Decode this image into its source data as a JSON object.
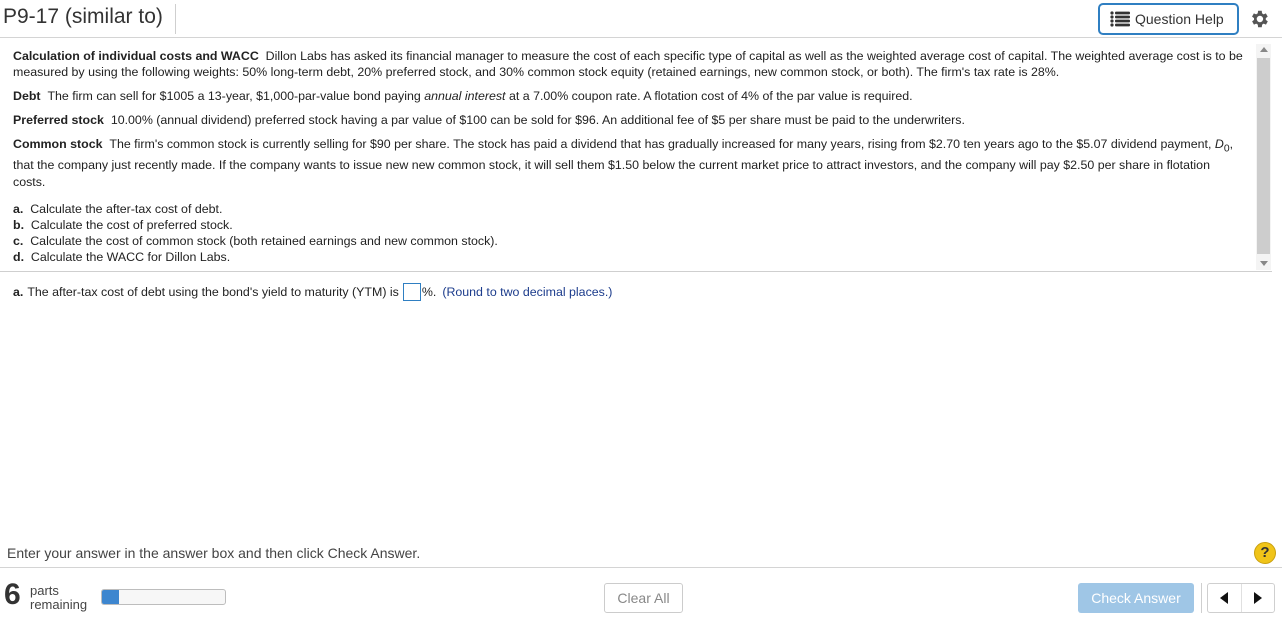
{
  "header": {
    "title": "P9-17 (similar to)",
    "question_help_label": "Question Help"
  },
  "problem": {
    "intro_heading": "Calculation of individual costs and WACC",
    "intro_text": "Dillon Labs has asked its financial manager to measure the cost of each specific type of capital as well as the weighted average cost of capital. The weighted average cost is to be measured by using the following weights: 50% long-term debt, 20% preferred stock, and 30% common stock equity (retained earnings, new common stock, or both). The firm's tax rate is 28%.",
    "debt_heading": "Debt",
    "debt_text_1": "The firm can sell for $1005 a 13-year, $1,000-par-value bond paying",
    "debt_text_italic": "annual interest",
    "debt_text_2": "at a 7.00% coupon rate. A flotation cost of 4% of the par value is required.",
    "preferred_heading": "Preferred stock",
    "preferred_text": "10.00% (annual dividend) preferred stock having a par value of $100 can be sold for $96. An additional fee of $5 per share must be paid to the underwriters.",
    "common_heading": "Common stock",
    "common_text_1": "The firm's common stock is currently selling for $90 per share. The stock has paid a dividend that has gradually increased for many years, rising from $2.70 ten years ago to the $5.07 dividend payment,",
    "common_d0": "D",
    "common_d0_sub": "0",
    "common_text_2": ", that the company just recently made. If the company wants to issue new new common stock, it will sell them $1.50 below the current market price to attract investors, and the company will pay $2.50 per share in flotation costs.",
    "tasks": [
      {
        "letter": "a.",
        "text": "Calculate the after-tax cost of debt."
      },
      {
        "letter": "b.",
        "text": "Calculate the cost of preferred stock."
      },
      {
        "letter": "c.",
        "text": "Calculate the cost of common stock (both retained earnings and new common stock)."
      },
      {
        "letter": "d.",
        "text": "Calculate the WACC for Dillon Labs."
      }
    ]
  },
  "answer": {
    "letter": "a.",
    "prompt": "The after-tax cost of debt using the bond's yield to maturity (YTM) is",
    "value": "",
    "suffix": "%.",
    "hint": "(Round to two decimal places.)"
  },
  "footer": {
    "instruction": "Enter your answer in the answer box and then click Check Answer.",
    "parts_count": "6",
    "parts_label_1": "parts",
    "parts_label_2": "remaining",
    "progress_fraction": 0.14,
    "clear_all_label": "Clear All",
    "check_answer_label": "Check Answer",
    "help_symbol": "?"
  },
  "colors": {
    "accent": "#2f7fc2",
    "progress_fill": "#3d86cf",
    "check_answer_bg": "#9fc6e6",
    "hint_text": "#1c3c8c",
    "help_icon": "#f0c419"
  },
  "icons": {
    "question_help": "list-icon",
    "settings": "gear-icon",
    "help": "question-circle-icon",
    "prev": "triangle-left-icon",
    "next": "triangle-right-icon"
  }
}
